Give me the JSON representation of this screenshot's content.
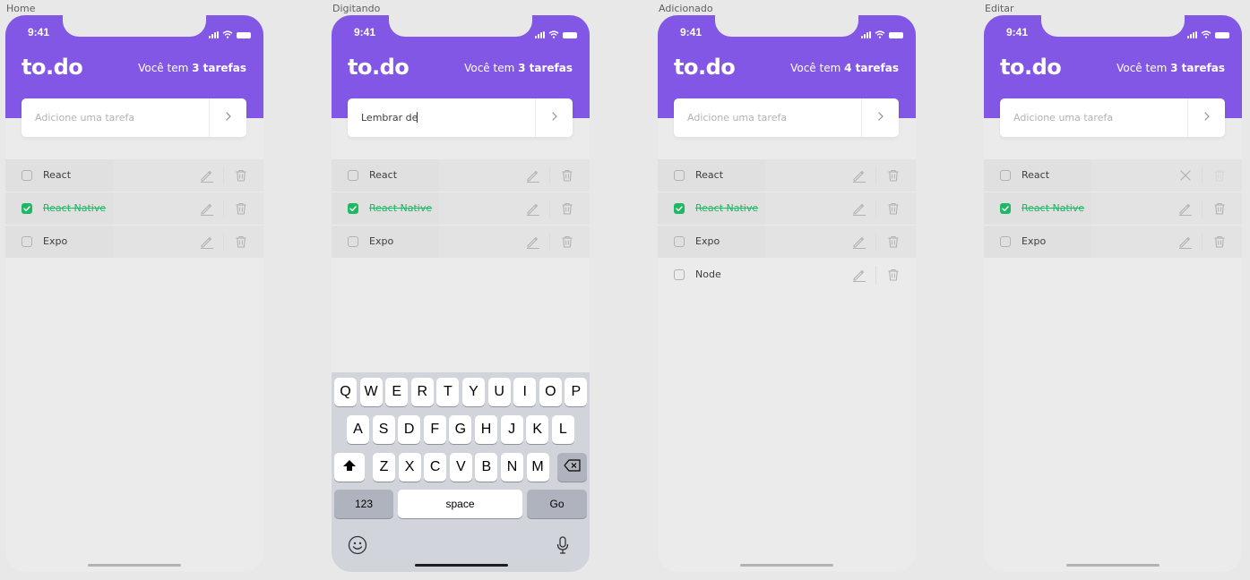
{
  "frames": [
    {
      "label": "Home",
      "time": "9:41",
      "logo": "to.do",
      "counter_prefix": "Você tem ",
      "counter_value": "3 tarefas",
      "input": {
        "text": "Adicione uma tarefa",
        "typed": false
      },
      "tasks": [
        {
          "label": "React",
          "done": false
        },
        {
          "label": "React Native",
          "done": true
        },
        {
          "label": "Expo",
          "done": false
        }
      ],
      "editing_index": -1
    },
    {
      "label": "Digitando",
      "time": "9:41",
      "logo": "to.do",
      "counter_prefix": "Você tem ",
      "counter_value": "3 tarefas",
      "input": {
        "text": "Lembrar de",
        "typed": true
      },
      "tasks": [
        {
          "label": "React",
          "done": false
        },
        {
          "label": "React Native",
          "done": true
        },
        {
          "label": "Expo",
          "done": false
        }
      ],
      "editing_index": -1,
      "keyboard": {
        "row1": [
          "Q",
          "W",
          "E",
          "R",
          "T",
          "Y",
          "U",
          "I",
          "O",
          "P"
        ],
        "row2": [
          "A",
          "S",
          "D",
          "F",
          "G",
          "H",
          "J",
          "K",
          "L"
        ],
        "row3": [
          "Z",
          "X",
          "C",
          "V",
          "B",
          "N",
          "M"
        ],
        "numbers_label": "123",
        "space_label": "space",
        "go_label": "Go"
      }
    },
    {
      "label": "Adicionado",
      "time": "9:41",
      "logo": "to.do",
      "counter_prefix": "Você tem ",
      "counter_value": "4 tarefas",
      "input": {
        "text": "Adicione uma tarefa",
        "typed": false
      },
      "tasks": [
        {
          "label": "React",
          "done": false
        },
        {
          "label": "React Native",
          "done": true
        },
        {
          "label": "Expo",
          "done": false
        },
        {
          "label": "Node",
          "done": false
        }
      ],
      "editing_index": -1
    },
    {
      "label": "Editar",
      "time": "9:41",
      "logo": "to.do",
      "counter_prefix": "Você tem ",
      "counter_value": "3 tarefas",
      "input": {
        "text": "Adicione uma tarefa",
        "typed": false
      },
      "tasks": [
        {
          "label": "React",
          "done": false
        },
        {
          "label": "React Native",
          "done": true
        },
        {
          "label": "Expo",
          "done": false
        }
      ],
      "editing_index": 0
    }
  ],
  "colors": {
    "primary": "#8257e5",
    "done": "#1db863",
    "text": "#3d3d3d",
    "placeholder": "#b2b2b2",
    "icon": "#b2b2b2",
    "background": "#ebebeb"
  },
  "icons": {
    "send": "chevron-right-icon",
    "edit": "pencil-icon",
    "delete": "trash-icon",
    "cancel": "close-icon",
    "check": "check-icon",
    "backspace": "backspace-icon",
    "shift": "shift-icon",
    "emoji": "emoji-icon",
    "mic": "microphone-icon"
  }
}
